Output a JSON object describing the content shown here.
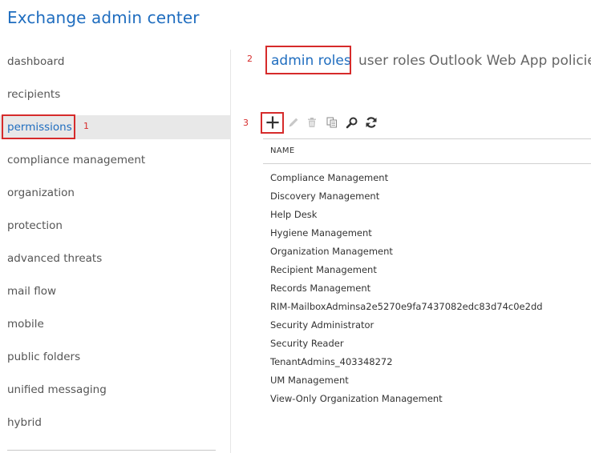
{
  "app": {
    "title": "Exchange admin center"
  },
  "sidebar": {
    "items": [
      {
        "label": "dashboard"
      },
      {
        "label": "recipients"
      },
      {
        "label": "permissions",
        "active": true
      },
      {
        "label": "compliance management"
      },
      {
        "label": "organization"
      },
      {
        "label": "protection"
      },
      {
        "label": "advanced threats"
      },
      {
        "label": "mail flow"
      },
      {
        "label": "mobile"
      },
      {
        "label": "public folders"
      },
      {
        "label": "unified messaging"
      },
      {
        "label": "hybrid"
      }
    ]
  },
  "tabs": [
    {
      "label": "admin roles",
      "active": true
    },
    {
      "label": "user roles"
    },
    {
      "label": "Outlook Web App policies"
    }
  ],
  "annotations": {
    "step1": "1",
    "step2": "2",
    "step3": "3"
  },
  "toolbar": {
    "icons": [
      "add-icon",
      "edit-icon",
      "delete-icon",
      "copy-icon",
      "search-icon",
      "refresh-icon"
    ]
  },
  "table": {
    "column_header": "NAME",
    "rows": [
      "Compliance Management",
      "Discovery Management",
      "Help Desk",
      "Hygiene Management",
      "Organization Management",
      "Recipient Management",
      "Records Management",
      "RIM-MailboxAdminsa2e5270e9fa7437082edc83d74c0e2dd",
      "Security Administrator",
      "Security Reader",
      "TenantAdmins_403348272",
      "UM Management",
      "View-Only Organization Management"
    ]
  },
  "colors": {
    "accent": "#1f6dbf",
    "highlight": "#d62b2b",
    "active_nav_bg": "#e8e8e8"
  }
}
